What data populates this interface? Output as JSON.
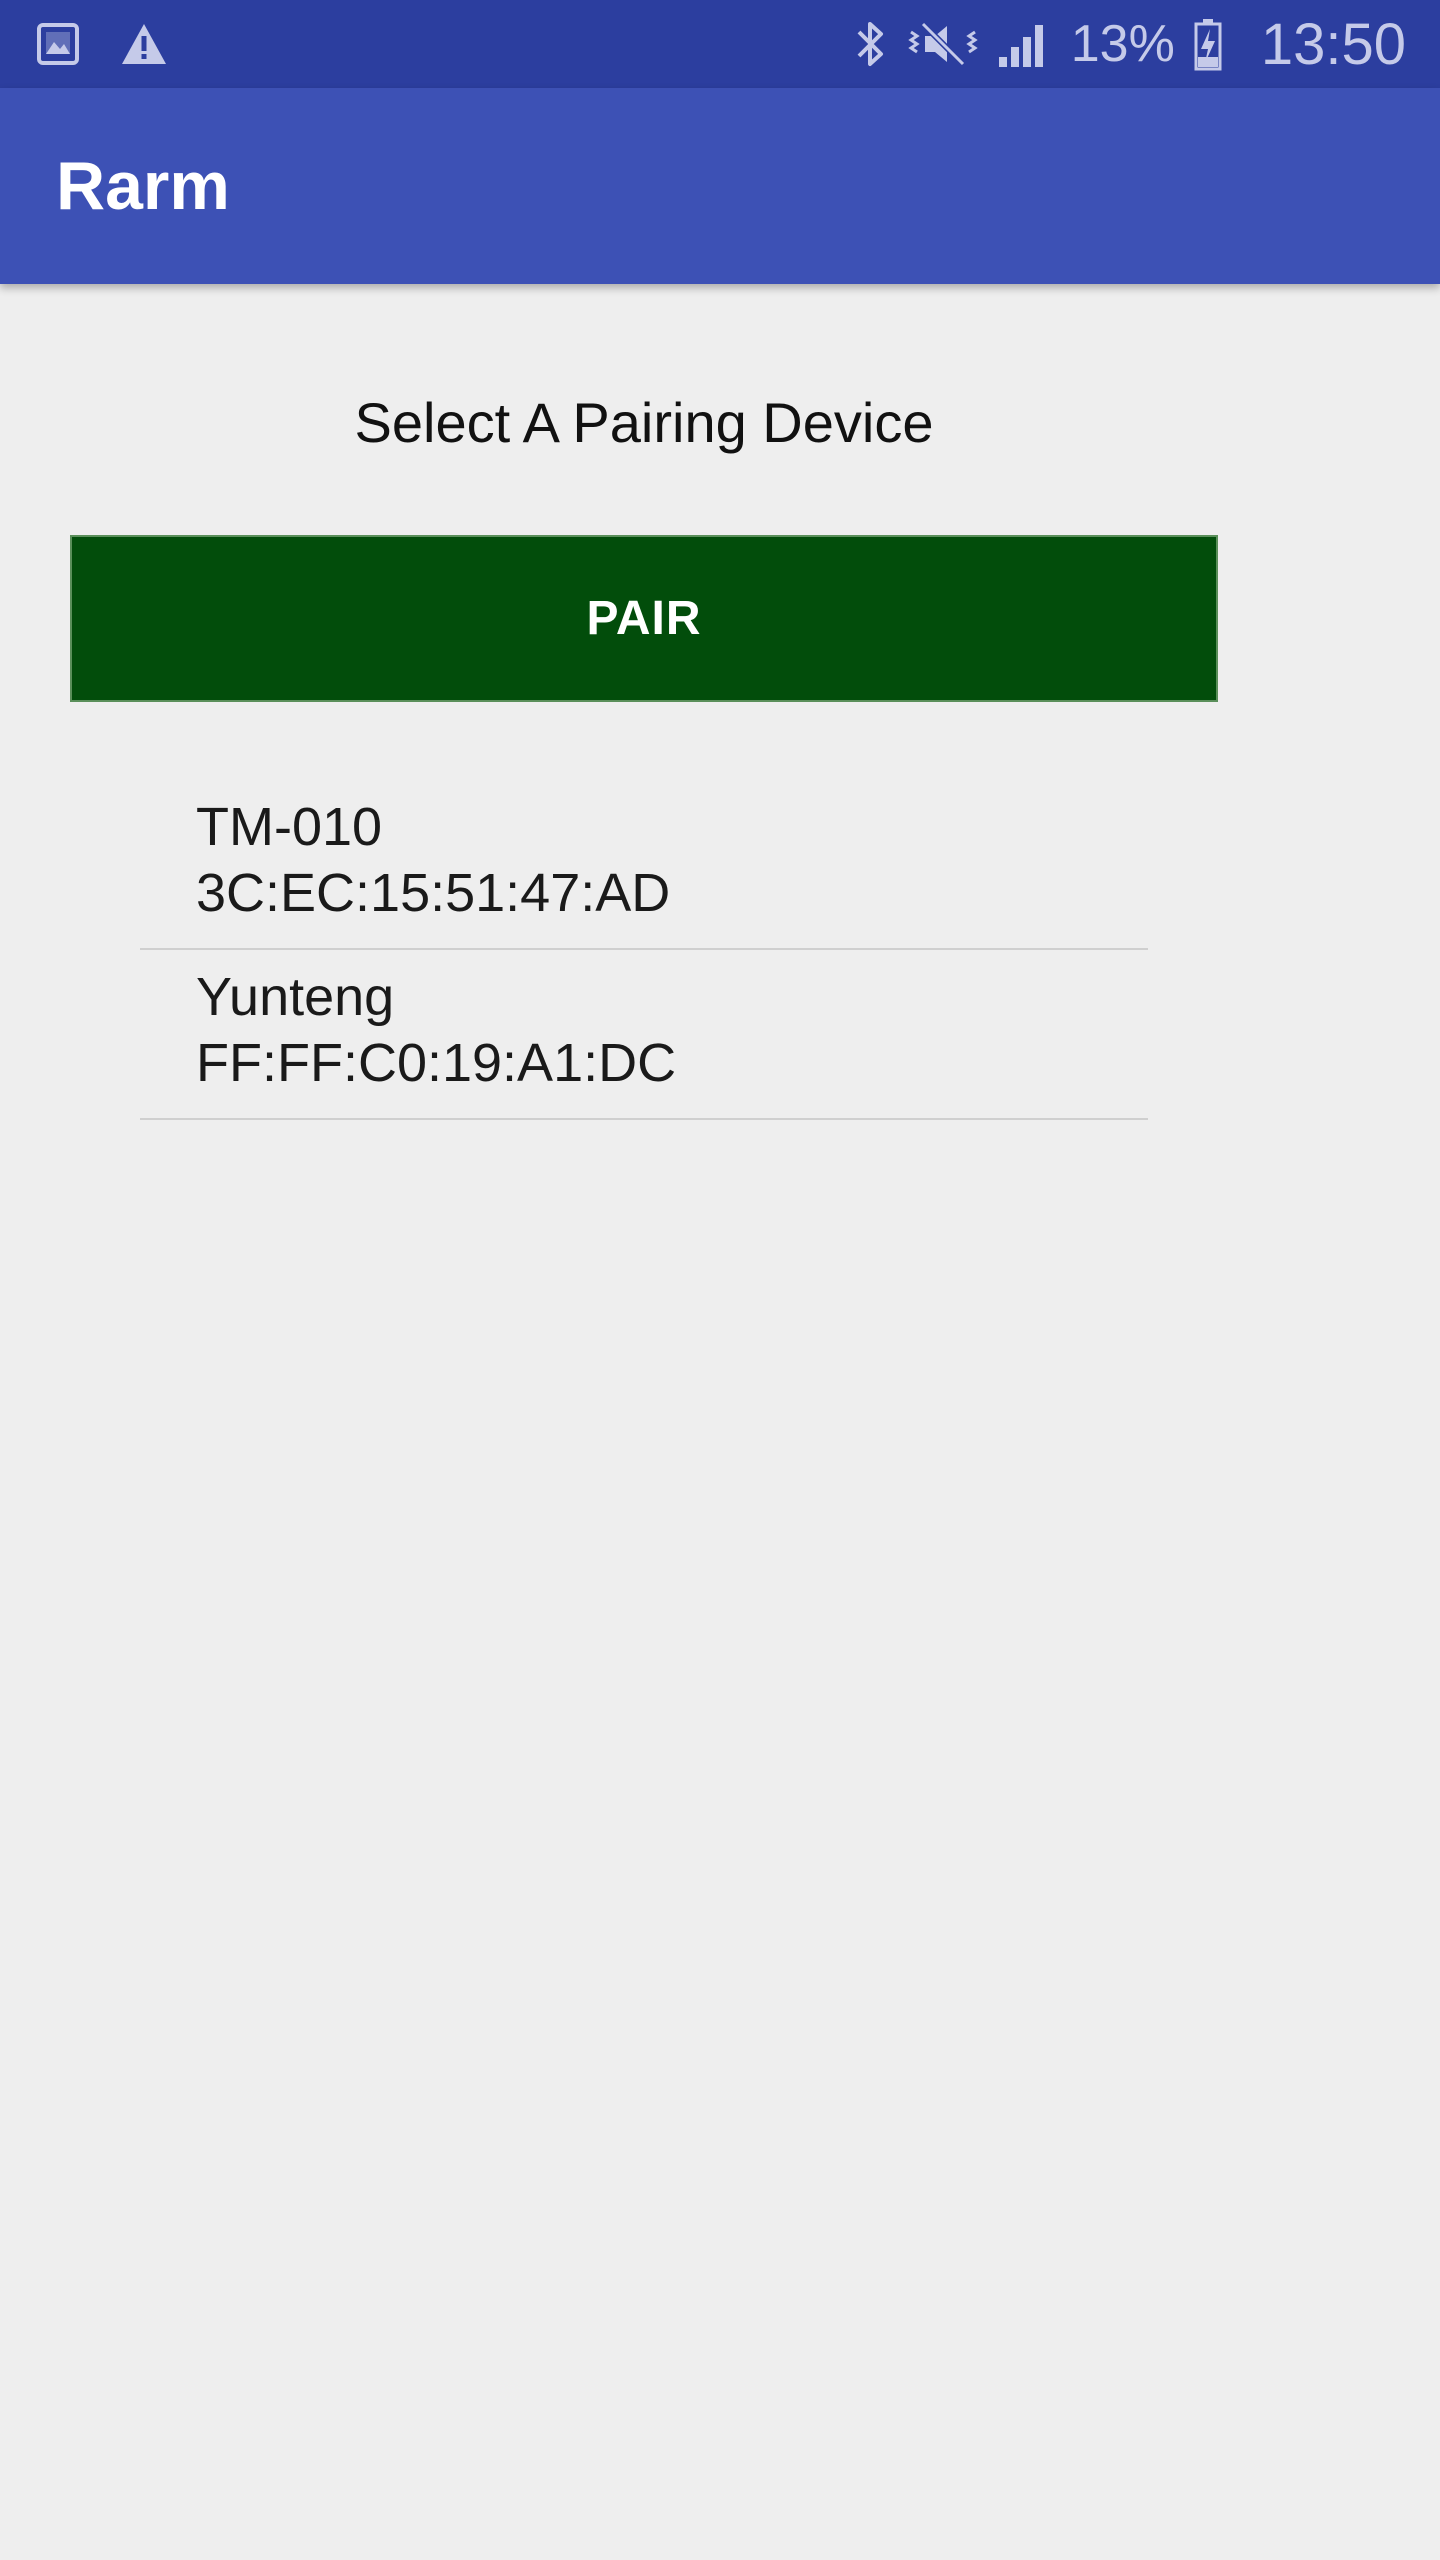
{
  "status_bar": {
    "battery_percent": "13%",
    "time": "13:50",
    "icons": [
      "image-notification-icon",
      "warning-icon",
      "bluetooth-icon",
      "mute-vibrate-icon",
      "signal-icon",
      "battery-charging-icon"
    ]
  },
  "app_bar": {
    "title": "Rarm"
  },
  "main": {
    "heading": "Select A Pairing Device",
    "pair_button_label": "PAIR",
    "devices": [
      {
        "name": "TM-010",
        "address": "3C:EC:15:51:47:AD"
      },
      {
        "name": "Yunteng",
        "address": "FF:FF:C0:19:A1:DC"
      }
    ]
  },
  "colors": {
    "status_bar": "#2c3e9f",
    "app_bar": "#3d51b5",
    "pair_button": "#024d0b",
    "background": "#eeeeee"
  }
}
